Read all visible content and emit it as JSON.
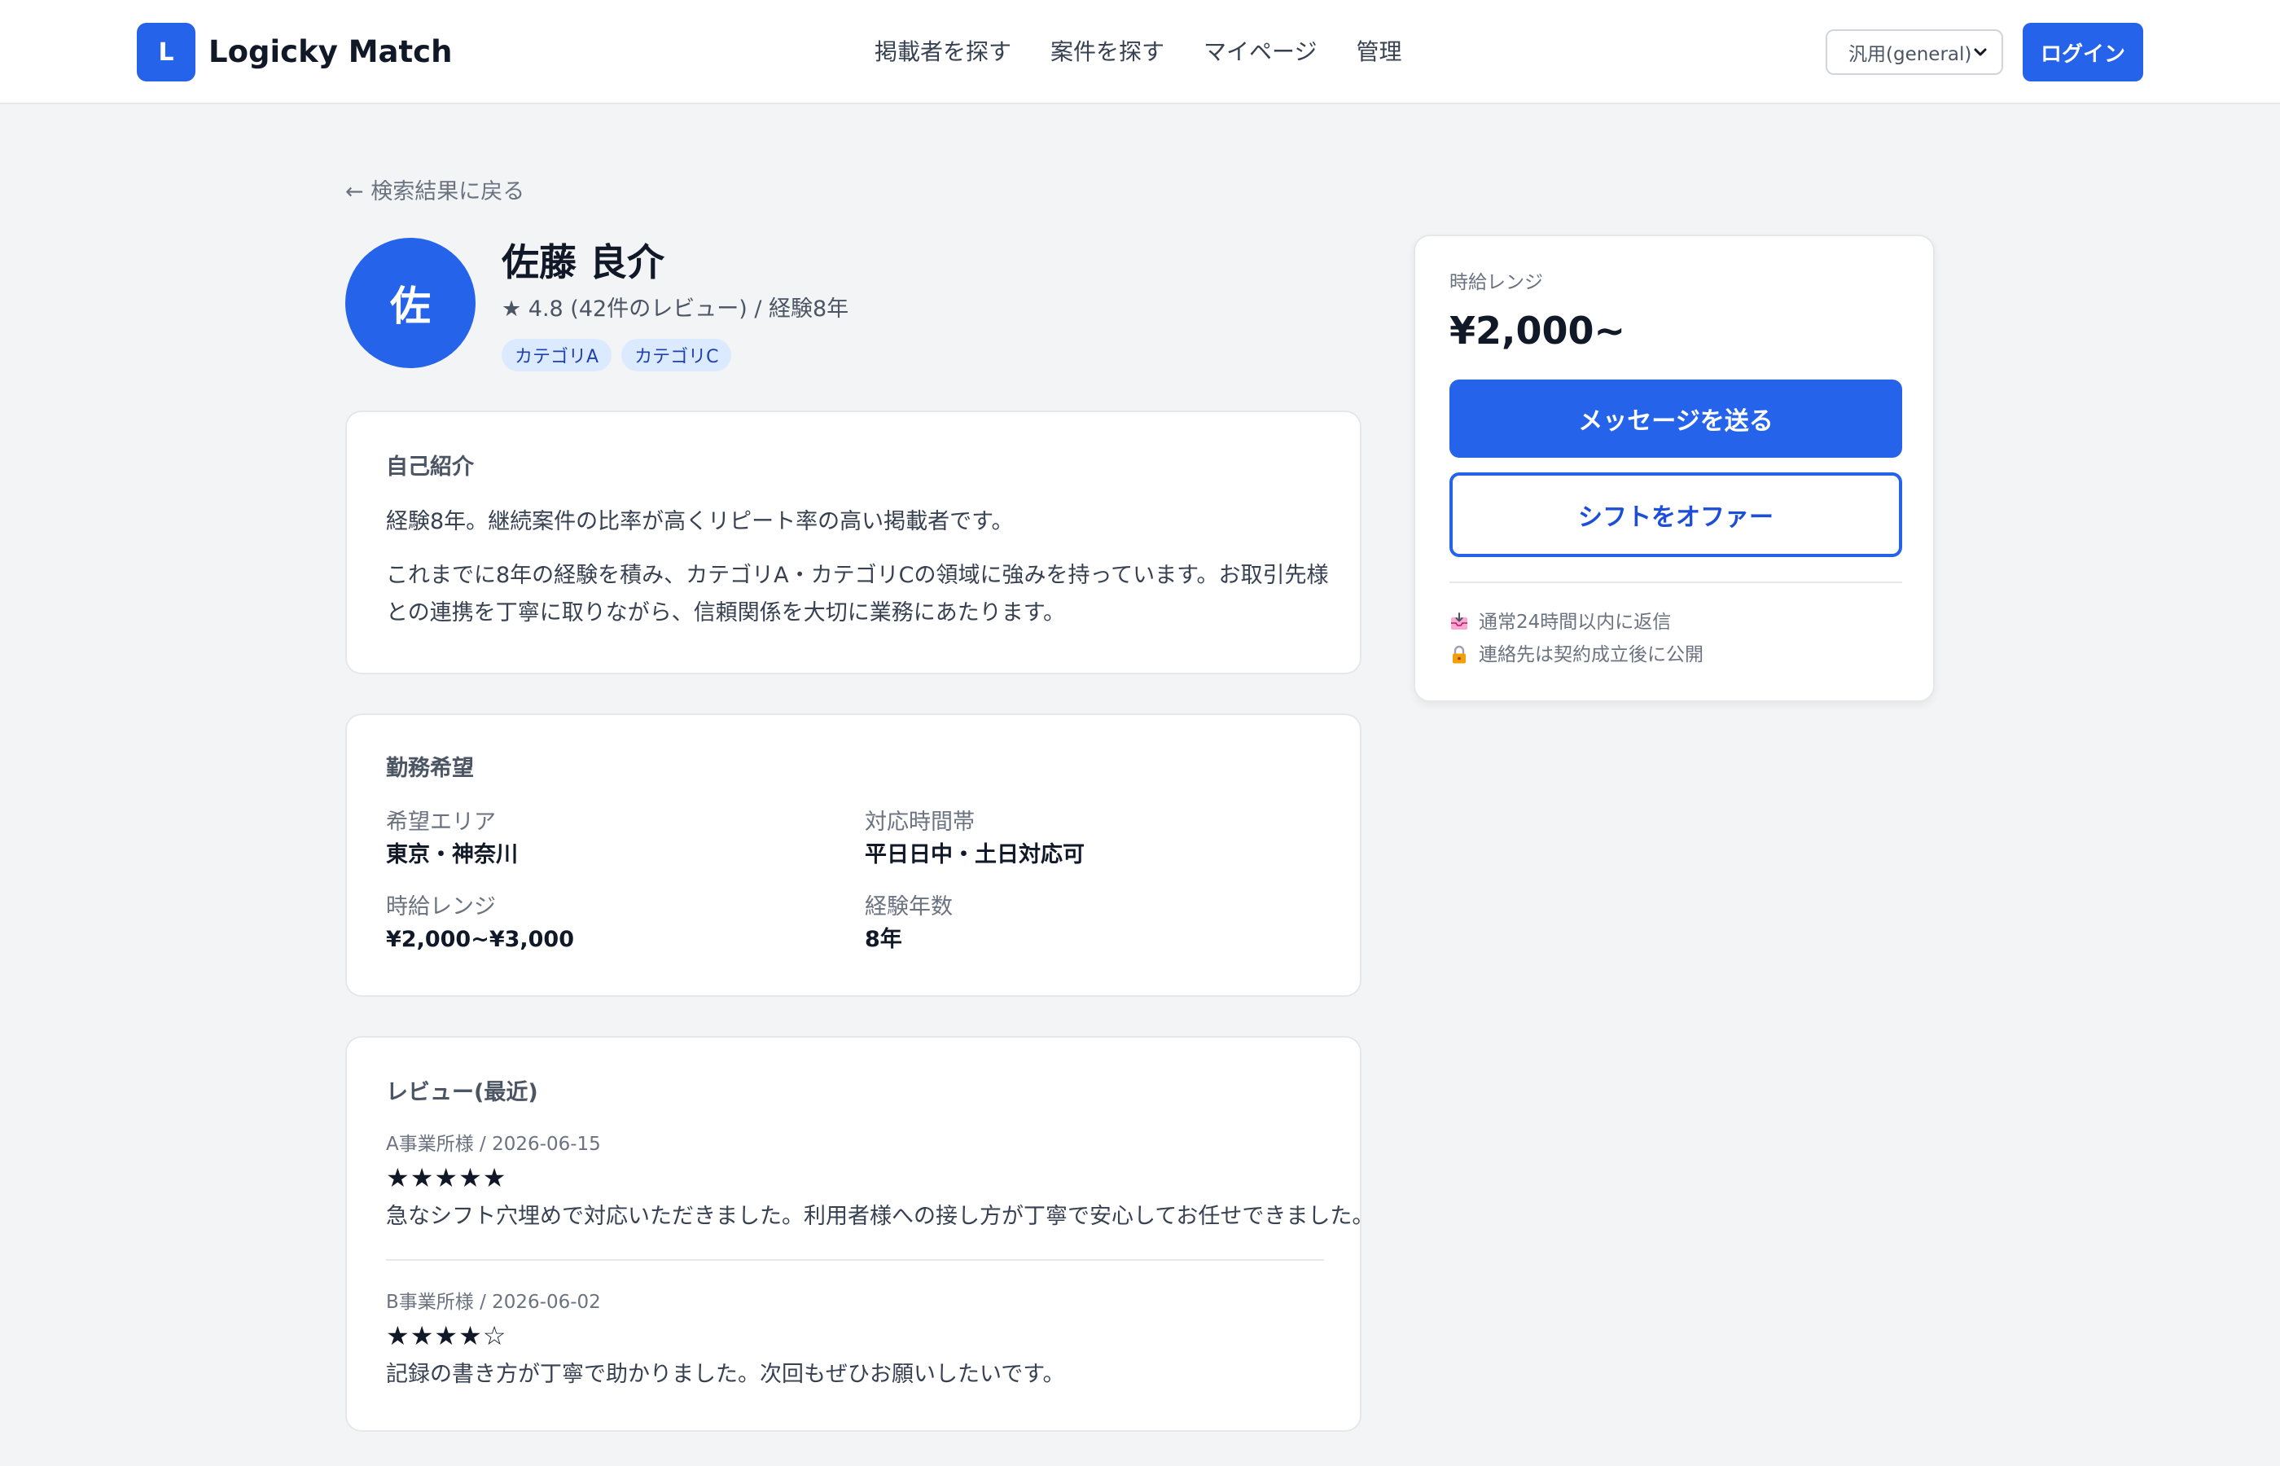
{
  "header": {
    "logo_letter": "L",
    "app_name": "Logicky Match",
    "nav": [
      "掲載者を探す",
      "案件を探す",
      "マイページ",
      "管理"
    ],
    "mode_select": "汎用(general)",
    "login_label": "ログイン"
  },
  "back_link": "← 検索結果に戻る",
  "profile": {
    "avatar_initial": "佐",
    "name": "佐藤 良介",
    "rating_line": "★ 4.8 (42件のレビュー) / 経験8年",
    "tags": [
      "カテゴリA",
      "カテゴリC"
    ]
  },
  "intro": {
    "title": "自己紹介",
    "line1": "経験8年。継続案件の比率が高くリピート率の高い掲載者です。",
    "line2": "これまでに8年の経験を積み、カテゴリA・カテゴリCの領域に強みを持っています。お取引先様との連携を丁寧に取りながら、信頼関係を大切に業務にあたります。"
  },
  "work": {
    "title": "勤務希望",
    "area_label": "希望エリア",
    "area_value": "東京・神奈川",
    "time_label": "対応時間帯",
    "time_value": "平日日中・土日対応可",
    "rate_label": "時給レンジ",
    "rate_value": "¥2,000~¥3,000",
    "exp_label": "経験年数",
    "exp_value": "8年"
  },
  "reviews": {
    "title": "レビュー(最近)",
    "items": [
      {
        "meta": "A事業所様 / 2026-06-15",
        "stars": "★★★★★",
        "text": "急なシフト穴埋めで対応いただきました。利用者様への接し方が丁寧で安心してお任せできました。"
      },
      {
        "meta": "B事業所様 / 2026-06-02",
        "stars": "★★★★☆",
        "text": "記録の書き方が丁寧で助かりました。次回もぜひお願いしたいです。"
      }
    ]
  },
  "side": {
    "rate_label": "時給レンジ",
    "rate_value": "¥2,000~",
    "message_button": "メッセージを送る",
    "offer_button": "シフトをオファー",
    "note1": "通常24時間以内に返信",
    "note2": "連絡先は契約成立後に公開",
    "note1_icon": "inbox-icon",
    "note2_icon": "lock-icon"
  },
  "colors": {
    "primary": "#2563eb",
    "background": "#f3f4f6",
    "card": "#ffffff",
    "tag_bg": "#dbeafe"
  }
}
